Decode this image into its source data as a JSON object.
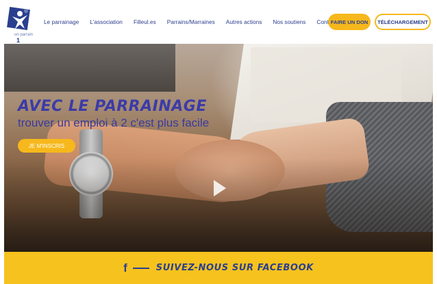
{
  "logo": {
    "line1": "un parrain",
    "line2": "1 emploi"
  },
  "nav": {
    "items": [
      "Le parrainage",
      "L'association",
      "Filleul.es",
      "Parrains/Marraines",
      "Autres actions",
      "Nos soutiens",
      "Contact"
    ],
    "donate_label": "FAIRE UN DON",
    "download_label": "TÉLÉCHARGEMENT"
  },
  "hero": {
    "headline": "AVEC LE PARRAINAGE",
    "subline": "trouver un emploi à 2 c'est plus facile",
    "cta_label": "JE M'INSCRIS"
  },
  "facebook": {
    "icon": "f",
    "label": "SUIVEZ-NOUS SUR FACEBOOK"
  },
  "colors": {
    "accent": "#f6b81c",
    "brand": "#2b3f8f"
  }
}
